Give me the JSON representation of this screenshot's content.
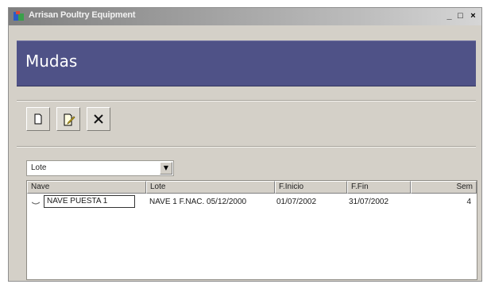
{
  "window": {
    "title": "Arrisan Poultry Equipment",
    "buttons": {
      "minimize": "_",
      "maximize": "□",
      "close": "×"
    }
  },
  "header": {
    "title": "Mudas"
  },
  "toolbar": {
    "buttons": [
      {
        "name": "new",
        "icon": "new-document-icon"
      },
      {
        "name": "edit",
        "icon": "edit-document-icon"
      },
      {
        "name": "delete",
        "icon": "delete-x-icon"
      }
    ]
  },
  "filter": {
    "selected": "Lote"
  },
  "list": {
    "columns": [
      "Nave",
      "Lote",
      "F.Inicio",
      "F.Fin",
      "Sem"
    ],
    "rows": [
      {
        "nave": "NAVE PUESTA 1",
        "lote": "NAVE 1 F.NAC. 05/12/2000",
        "f_inicio": "01/07/2002",
        "f_fin": "31/07/2002",
        "sem": "4"
      }
    ]
  },
  "colors": {
    "header_band": "#4f5287",
    "window_bg": "#d4d0c8"
  }
}
